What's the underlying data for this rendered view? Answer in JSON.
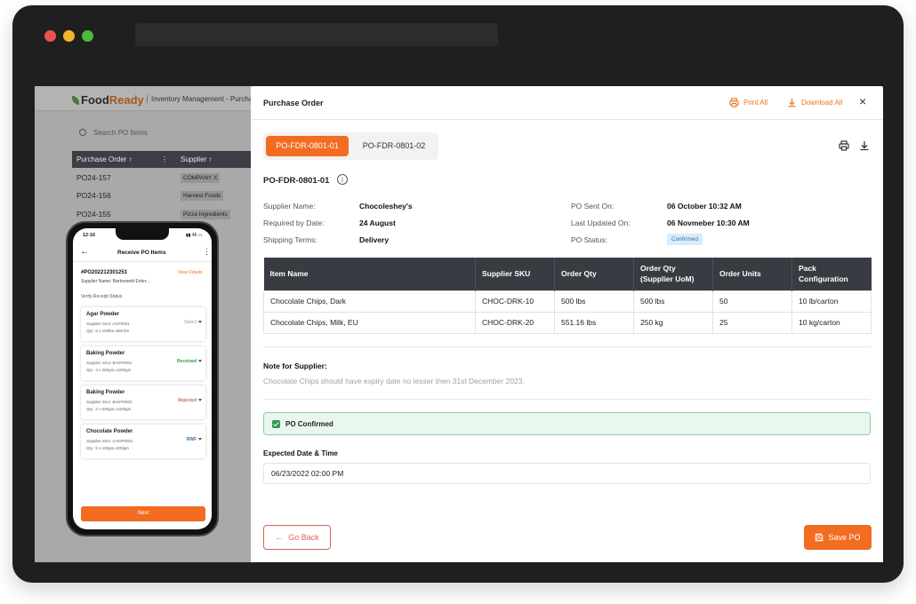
{
  "colors": {
    "accent": "#f26c22",
    "header_dark": "#383c42",
    "success": "#2f9950",
    "danger": "#d9635c",
    "info_badge_bg": "#d8ecfb"
  },
  "background_app": {
    "logo_food": "Food",
    "logo_ready": "Ready",
    "header_title": "Inventory Management - Purcha",
    "search_placeholder": "Search PO Items",
    "columns": [
      "Purchase Order ↑",
      "Supplier ↑"
    ],
    "rows": [
      {
        "po": "PO24-157",
        "supplier": "COMPANY X"
      },
      {
        "po": "PO24-156",
        "supplier": "Harvest Foods"
      },
      {
        "po": "PO24-155",
        "supplier": "Pizza Ingredients"
      }
    ]
  },
  "phone": {
    "time": "12:16",
    "status": "46",
    "title": "Receive PO Items",
    "po_number": "#PO202212301251",
    "view_details": "View Details",
    "supplier_line": "Supplier Name: Bartoonetti Enter...",
    "section": "Verify Receipt Status",
    "items": [
      {
        "name": "Agar Powder",
        "sku": "Supplier SKU: AGP0001",
        "qty": "Qty.: 5 x 100lbs=500 lbs",
        "status": "Select",
        "status_color": "#9a9a9a"
      },
      {
        "name": "Baking Powder",
        "sku": "Supplier SKU: BAKP0001",
        "qty": "Qty.: 4 x 250gm=1000gm",
        "status": "Received",
        "status_color": "#2f9950"
      },
      {
        "name": "Baking Powder",
        "sku": "Supplier SKU: BAKP0002",
        "qty": "Qty.: 2 x 500gm=1000gm",
        "status": "Rejected",
        "status_color": "#d9635c"
      },
      {
        "name": "Chocolate Powder",
        "sku": "Supplier SKU: CHOP0001",
        "qty": "Qty.: 5 x 100gm=500gm",
        "status": "RWF",
        "status_color": "#3a6ea5"
      }
    ],
    "next_label": "Next"
  },
  "modal": {
    "title": "Purchase Order",
    "print_all": "Print All",
    "download_all": "Download All",
    "tabs": [
      "PO-FDR-0801-01",
      "PO-FDR-0801-02"
    ],
    "active_tab": 0,
    "po_id": "PO-FDR-0801-01",
    "info_left": [
      {
        "label": "Supplier Name:",
        "value": "Chocoleshey's"
      },
      {
        "label": "Required by Date:",
        "value": "24 August"
      },
      {
        "label": "Shipping Terms:",
        "value": "Delivery"
      }
    ],
    "info_right": [
      {
        "label": "PO Sent On:",
        "value": "06 October 10:32 AM"
      },
      {
        "label": "Last Updated On:",
        "value": "06 Novmeber 10:30 AM"
      },
      {
        "label": "PO Status:",
        "value": "Confirmed"
      }
    ],
    "table": {
      "headers": [
        "Item Name",
        "Supplier SKU",
        "Order Qty",
        "Order Qty\n(Supplier UoM)",
        "Order Units",
        "Pack\nConfiguration"
      ],
      "rows": [
        [
          "Chocolate Chips, Dark",
          "CHOC-DRK-10",
          "500 lbs",
          "500 lbs",
          "50",
          "10 lb/carton"
        ],
        [
          "Chocolate Chips, Milk, EU",
          "CHOC-DRK-20",
          "551.16 lbs",
          "250 kg",
          "25",
          "10 kg/carton"
        ]
      ]
    },
    "note_label": "Note for Supplier:",
    "note_text": "Chocolate Chips should have expiry date no lesser then 31st December 2023.",
    "confirmed_label": "PO Confirmed",
    "date_label": "Expected Date & Time",
    "date_value": "06/23/2022 02:00 PM",
    "go_back": "Go Back",
    "save": "Save PO"
  }
}
